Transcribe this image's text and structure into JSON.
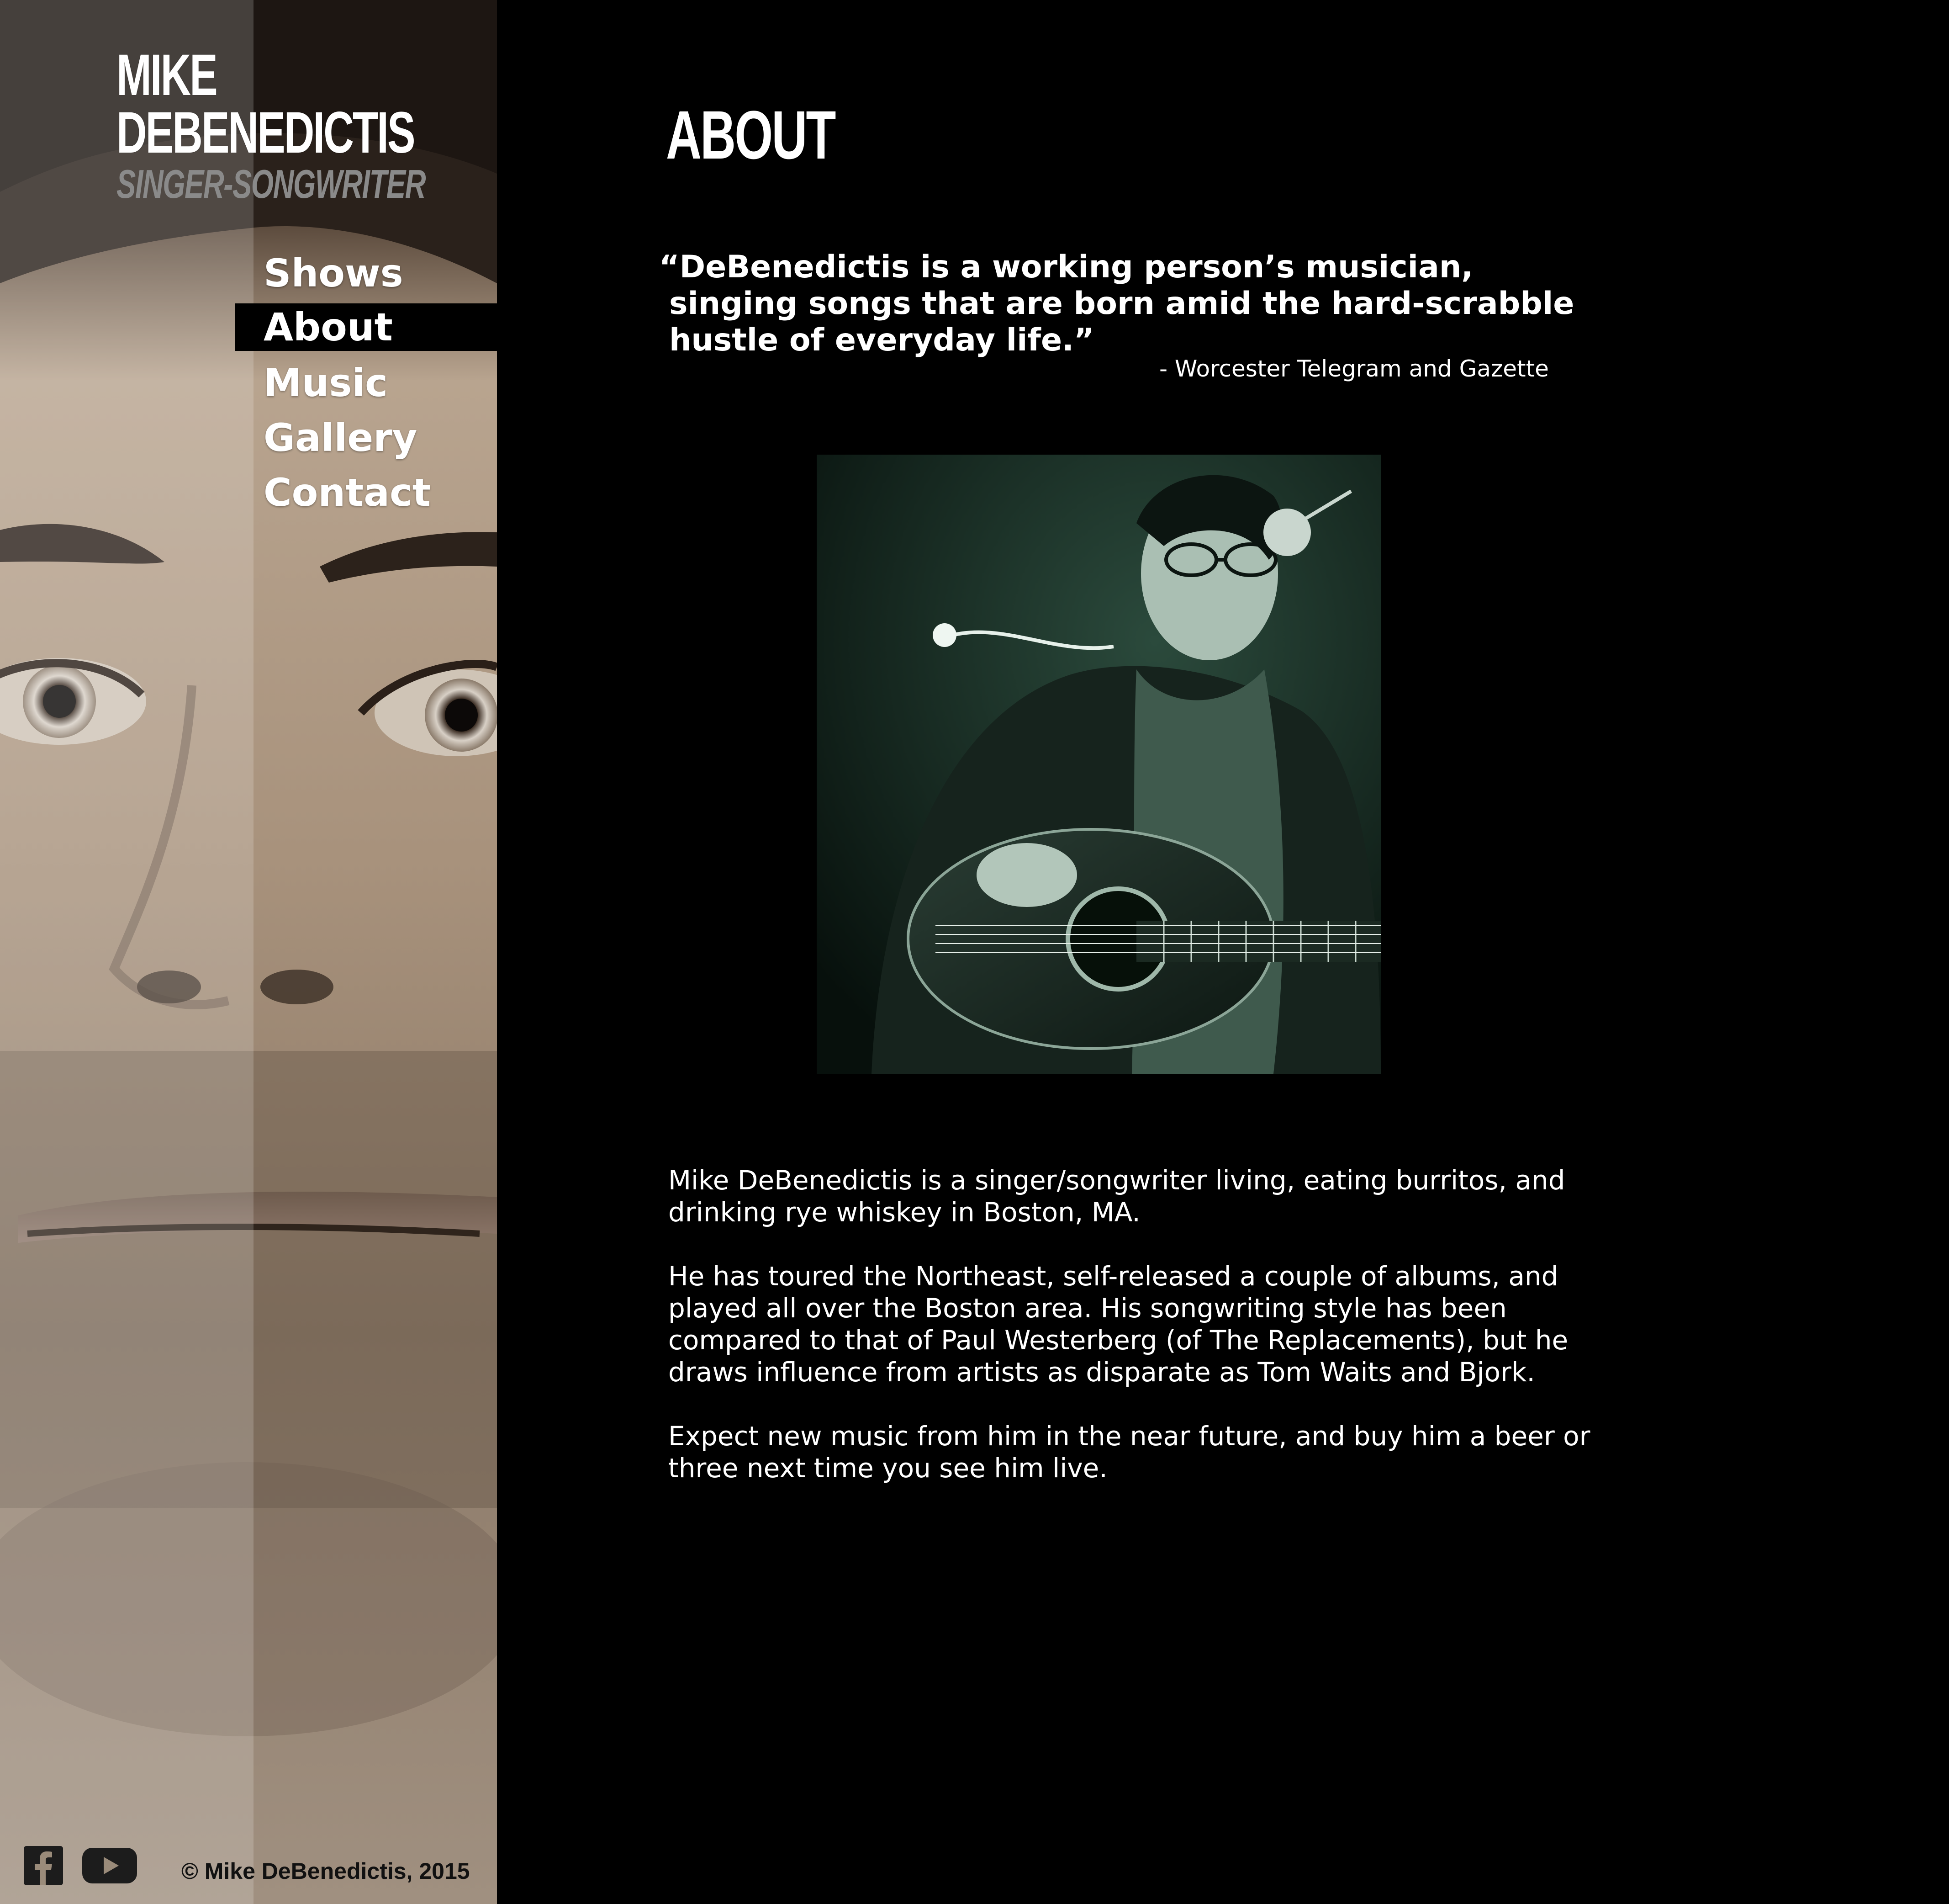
{
  "brand": {
    "name_line1": "MIKE",
    "name_line2": "DEBENEDICTIS",
    "subtitle": "SINGER-SONGWRITER"
  },
  "nav": {
    "items": [
      {
        "label": "Shows",
        "active": false
      },
      {
        "label": "About",
        "active": true
      },
      {
        "label": "Music",
        "active": false
      },
      {
        "label": "Gallery",
        "active": false
      },
      {
        "label": "Contact",
        "active": false
      }
    ]
  },
  "footer": {
    "social_icons": [
      "facebook-icon",
      "youtube-icon"
    ],
    "copyright": "© Mike DeBenedictis, 2015"
  },
  "main": {
    "title": "ABOUT",
    "quote": {
      "line1": "“DeBenedictis is a working person’s musician,",
      "line2": "singing songs that are born amid the hard-scrabble",
      "line3": "hustle of everyday life.”",
      "attribution": "- Worcester Telegram and Gazette"
    },
    "bio": [
      "Mike DeBenedictis is a singer/songwriter living, eating burritos, and\ndrinking rye whiskey in Boston, MA.",
      "He has toured the Northeast, self-released a couple of albums, and\nplayed all over the Boston area. His songwriting style has been\ncompared to that of Paul Westerberg (of The Replacements), but he\ndraws influence from artists as disparate as Tom Waits and Bjork.",
      "Expect new music from him in the near future, and buy him a beer or\nthree next time you see him live."
    ]
  },
  "colors": {
    "background": "#000000",
    "text": "#ffffff",
    "subtitle": "#8a8a8a",
    "sidebar_tone": "#9a8b7a",
    "photo_tint": "#1e3a2e"
  }
}
